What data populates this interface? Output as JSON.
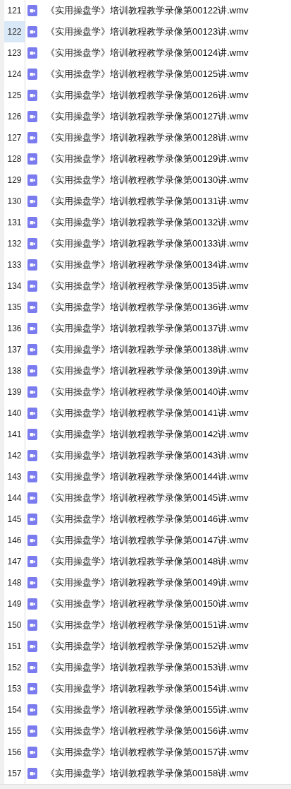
{
  "rows": [
    {
      "number": "121",
      "name": "《实用操盘学》培训教程教学录像第00122讲.wmv",
      "selected": false
    },
    {
      "number": "122",
      "name": "《实用操盘学》培训教程教学录像第00123讲.wmv",
      "selected": true
    },
    {
      "number": "123",
      "name": "《实用操盘学》培训教程教学录像第00124讲.wmv",
      "selected": false
    },
    {
      "number": "124",
      "name": "《实用操盘学》培训教程教学录像第00125讲.wmv",
      "selected": false
    },
    {
      "number": "125",
      "name": "《实用操盘学》培训教程教学录像第00126讲.wmv",
      "selected": false
    },
    {
      "number": "126",
      "name": "《实用操盘学》培训教程教学录像第00127讲.wmv",
      "selected": false
    },
    {
      "number": "127",
      "name": "《实用操盘学》培训教程教学录像第00128讲.wmv",
      "selected": false
    },
    {
      "number": "128",
      "name": "《实用操盘学》培训教程教学录像第00129讲.wmv",
      "selected": false
    },
    {
      "number": "129",
      "name": "《实用操盘学》培训教程教学录像第00130讲.wmv",
      "selected": false
    },
    {
      "number": "130",
      "name": "《实用操盘学》培训教程教学录像第00131讲.wmv",
      "selected": false
    },
    {
      "number": "131",
      "name": "《实用操盘学》培训教程教学录像第00132讲.wmv",
      "selected": false
    },
    {
      "number": "132",
      "name": "《实用操盘学》培训教程教学录像第00133讲.wmv",
      "selected": false
    },
    {
      "number": "133",
      "name": "《实用操盘学》培训教程教学录像第00134讲.wmv",
      "selected": false
    },
    {
      "number": "134",
      "name": "《实用操盘学》培训教程教学录像第00135讲.wmv",
      "selected": false
    },
    {
      "number": "135",
      "name": "《实用操盘学》培训教程教学录像第00136讲.wmv",
      "selected": false
    },
    {
      "number": "136",
      "name": "《实用操盘学》培训教程教学录像第00137讲.wmv",
      "selected": false
    },
    {
      "number": "137",
      "name": "《实用操盘学》培训教程教学录像第00138讲.wmv",
      "selected": false
    },
    {
      "number": "138",
      "name": "《实用操盘学》培训教程教学录像第00139讲.wmv",
      "selected": false
    },
    {
      "number": "139",
      "name": "《实用操盘学》培训教程教学录像第00140讲.wmv",
      "selected": false
    },
    {
      "number": "140",
      "name": "《实用操盘学》培训教程教学录像第00141讲.wmv",
      "selected": false
    },
    {
      "number": "141",
      "name": "《实用操盘学》培训教程教学录像第00142讲.wmv",
      "selected": false
    },
    {
      "number": "142",
      "name": "《实用操盘学》培训教程教学录像第00143讲.wmv",
      "selected": false
    },
    {
      "number": "143",
      "name": "《实用操盘学》培训教程教学录像第00144讲.wmv",
      "selected": false
    },
    {
      "number": "144",
      "name": "《实用操盘学》培训教程教学录像第00145讲.wmv",
      "selected": false
    },
    {
      "number": "145",
      "name": "《实用操盘学》培训教程教学录像第00146讲.wmv",
      "selected": false
    },
    {
      "number": "146",
      "name": "《实用操盘学》培训教程教学录像第00147讲.wmv",
      "selected": false
    },
    {
      "number": "147",
      "name": "《实用操盘学》培训教程教学录像第00148讲.wmv",
      "selected": false
    },
    {
      "number": "148",
      "name": "《实用操盘学》培训教程教学录像第00149讲.wmv",
      "selected": false
    },
    {
      "number": "149",
      "name": "《实用操盘学》培训教程教学录像第00150讲.wmv",
      "selected": false
    },
    {
      "number": "150",
      "name": "《实用操盘学》培训教程教学录像第00151讲.wmv",
      "selected": false
    },
    {
      "number": "151",
      "name": "《实用操盘学》培训教程教学录像第00152讲.wmv",
      "selected": false
    },
    {
      "number": "152",
      "name": "《实用操盘学》培训教程教学录像第00153讲.wmv",
      "selected": false
    },
    {
      "number": "153",
      "name": "《实用操盘学》培训教程教学录像第00154讲.wmv",
      "selected": false
    },
    {
      "number": "154",
      "name": "《实用操盘学》培训教程教学录像第00155讲.wmv",
      "selected": false
    },
    {
      "number": "155",
      "name": "《实用操盘学》培训教程教学录像第00156讲.wmv",
      "selected": false
    },
    {
      "number": "156",
      "name": "《实用操盘学》培训教程教学录像第00157讲.wmv",
      "selected": false
    },
    {
      "number": "157",
      "name": "《实用操盘学》培训教程教学录像第00158讲.wmv",
      "selected": false
    }
  ]
}
